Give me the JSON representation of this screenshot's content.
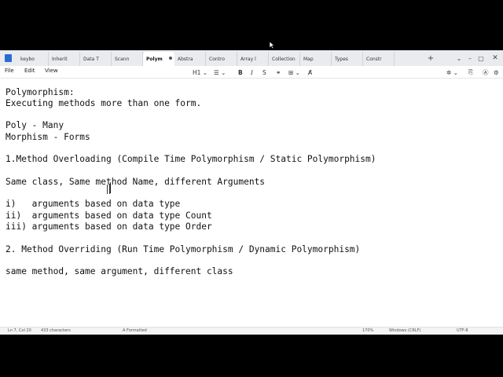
{
  "tabs": [
    {
      "label": "keybo",
      "active": false
    },
    {
      "label": "Inherit",
      "active": false
    },
    {
      "label": "Data T",
      "active": false
    },
    {
      "label": "Scann",
      "active": false
    },
    {
      "label": "Polym",
      "active": true
    },
    {
      "label": "Abstra",
      "active": false
    },
    {
      "label": "Contro",
      "active": false
    },
    {
      "label": "Array l",
      "active": false
    },
    {
      "label": "Collections",
      "active": false
    },
    {
      "label": "Map",
      "active": false
    },
    {
      "label": "Types",
      "active": false
    },
    {
      "label": "Constr",
      "active": false
    }
  ],
  "tabbar_icons": {
    "back": "‹",
    "new_tab": "+",
    "list": "⌄",
    "minimize": "–",
    "maximize": "▢",
    "close": "✕"
  },
  "menu": {
    "file": "File",
    "edit": "Edit",
    "view": "View"
  },
  "format_toolbar": {
    "heading": "H1 ⌄",
    "list": "☰ ⌄",
    "bold": "B",
    "italic": "I",
    "strike": "S",
    "link": "⚭",
    "table": "⊞ ⌄",
    "clear": "A̸"
  },
  "right_toolbar": {
    "copilot": "✲ ⌄",
    "share": "⎘",
    "avatar": "Ⓐ",
    "settings": "⚙"
  },
  "document": {
    "lines": [
      "Polymorphism:",
      "Executing methods more than one form.",
      "",
      "Poly - Many",
      "Morphism - Forms",
      "",
      "1.Method Overloading (Compile Time Polymorphism / Static Polymorphism)",
      "",
      "Same class, Same method Name, different Arguments",
      "",
      "i)   arguments based on data type",
      "ii)  arguments based on data type Count",
      "iii) arguments based on data type Order",
      "",
      "2. Method Overriding (Run Time Polymorphism / Dynamic Polymorphism)",
      "",
      "same method, same argument, different class"
    ]
  },
  "status": {
    "position": "Ln 7, Col 20",
    "characters": "433 characters",
    "format": "A Formatted",
    "zoom": "170%",
    "line_endings": "Windows (CRLF)",
    "encoding": "UTF-8"
  },
  "colors": {
    "accent": "#2b6cd4",
    "tabbar": "#e9ebef",
    "text": "#111111"
  }
}
